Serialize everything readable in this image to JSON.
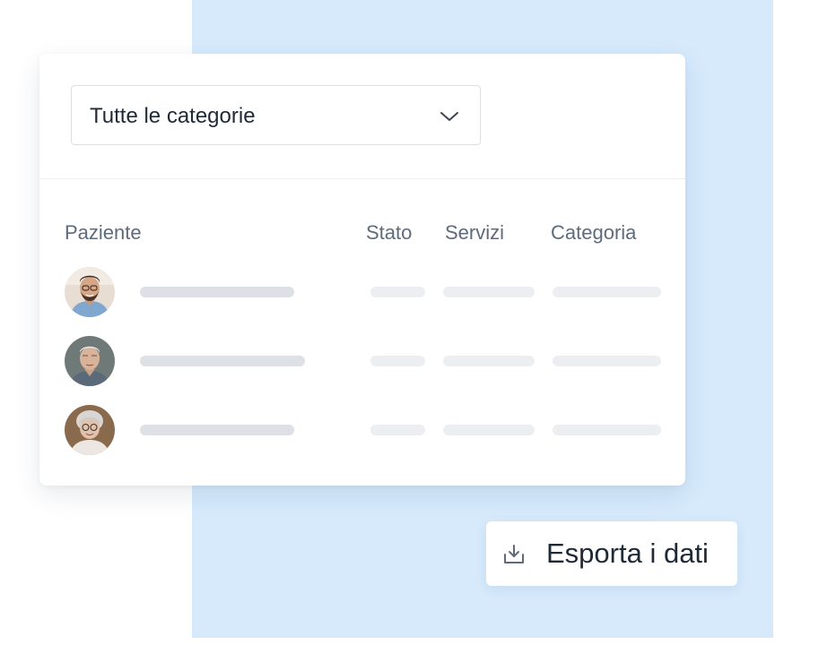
{
  "filter": {
    "selected": "Tutte le categorie"
  },
  "table": {
    "columns": [
      "Paziente",
      "Stato",
      "Servizi",
      "Categoria"
    ],
    "rows": [
      {
        "avatar": "young-man-with-beard-glasses"
      },
      {
        "avatar": "elderly-man"
      },
      {
        "avatar": "elderly-woman-with-glasses"
      }
    ]
  },
  "export_button": {
    "label": "Esporta i dati",
    "icon": "download-tray-icon"
  },
  "colors": {
    "background_panel": "#d6eafc",
    "placeholder_dark": "#dde0e4",
    "placeholder_light": "#eceef2",
    "header_text": "#5e6b7b",
    "text": "#1f2a37"
  }
}
